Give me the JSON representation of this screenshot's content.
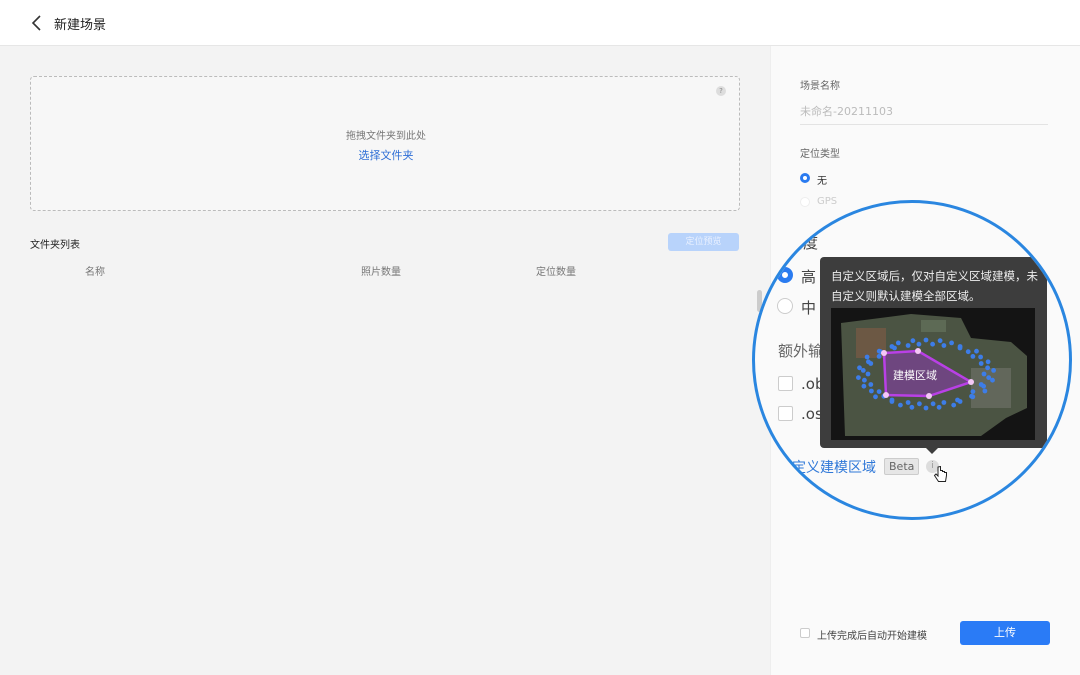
{
  "header": {
    "title": "新建场景",
    "back_icon": "chevron-left-icon"
  },
  "dropzone": {
    "hint": "拖拽文件夹到此处",
    "select_link": "选择文件夹",
    "help": "?"
  },
  "folder_list": {
    "title": "文件夹列表",
    "preview_button": "定位预览",
    "columns": [
      "名称",
      "照片数量",
      "定位数量"
    ]
  },
  "panel": {
    "scene_name_label": "场景名称",
    "scene_name_value": "未命名-20211103",
    "positioning_label": "定位类型",
    "positioning_options": [
      {
        "label": "无",
        "selected": true
      },
      {
        "label": "GPS",
        "disabled": true
      }
    ],
    "precision_label": "精度",
    "precision_options": [
      {
        "label": "高",
        "selected": true
      },
      {
        "label": "中",
        "selected": false
      }
    ],
    "extra_output_label": "额外输出",
    "extra_outputs": [
      {
        "label": ".obj",
        "checked": false
      },
      {
        "label": ".osgb",
        "checked": false
      }
    ],
    "custom_region_link": "自定义建模区域",
    "beta_badge": "Beta",
    "info_icon": "i",
    "tooltip_text": "自定义区域后，仅对自定义区域建模，未自定义则默认建模全部区域。",
    "map_label": "建模区域",
    "auto_start_label": "上传完成后自动开始建模",
    "auto_start_checked": false,
    "upload_button": "上传"
  },
  "colors": {
    "accent": "#2a7bf6",
    "lens_border": "#2a86e0",
    "region": "#b23bd6"
  }
}
